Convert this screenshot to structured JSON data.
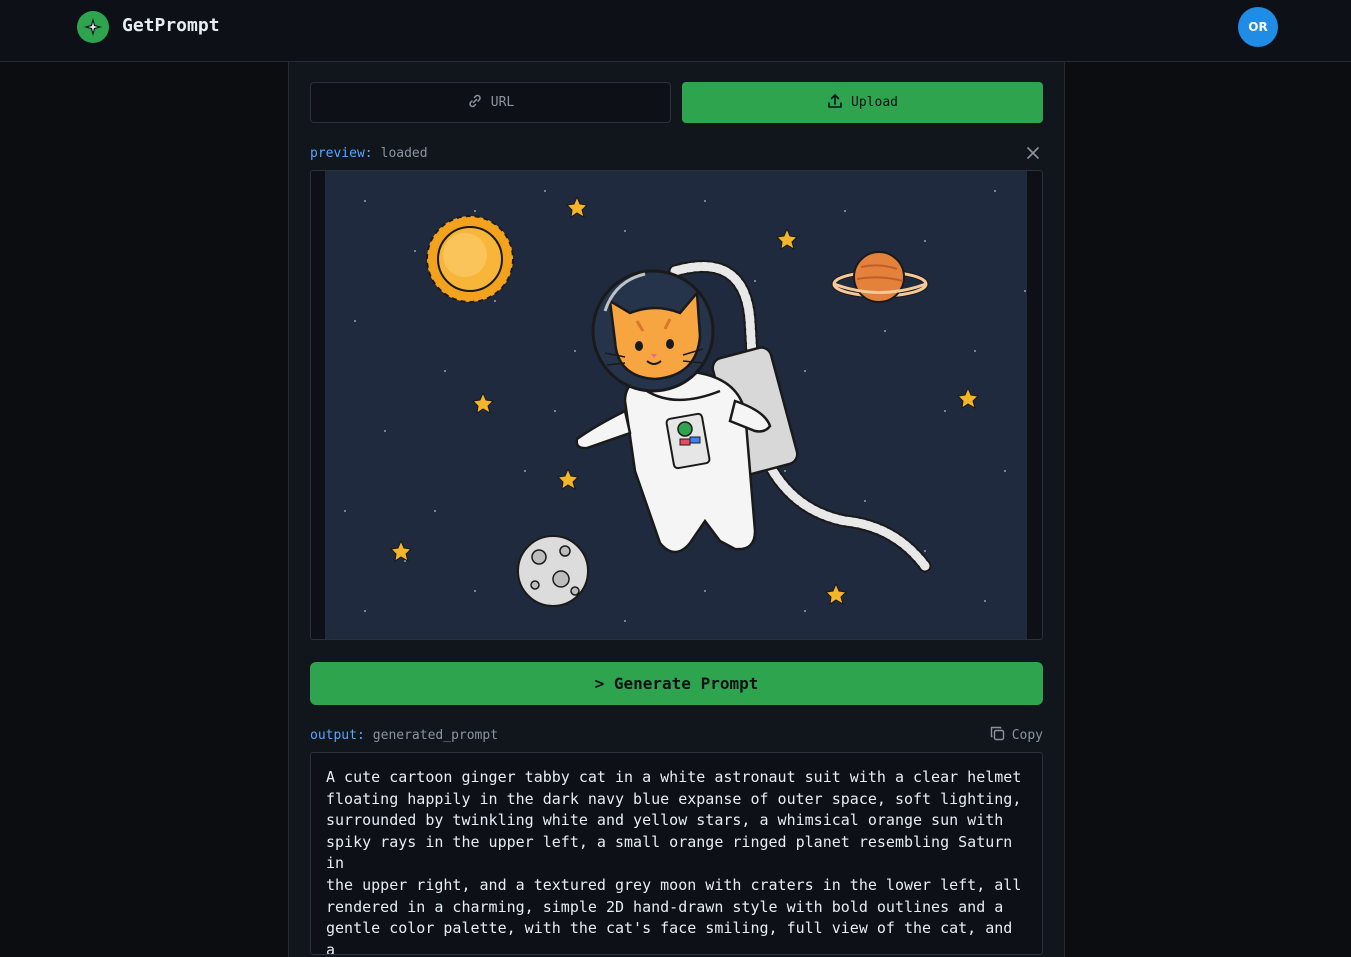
{
  "app": {
    "name": "GetPrompt",
    "avatar_initials": "OR"
  },
  "tabs": {
    "url_label": "URL",
    "upload_label": "Upload",
    "active": "Upload"
  },
  "preview": {
    "key": "preview:",
    "status": "loaded"
  },
  "generate": {
    "label": "> Generate Prompt"
  },
  "output": {
    "key": "output:",
    "name": "generated_prompt",
    "copy_label": "Copy",
    "text": "A cute cartoon ginger tabby cat in a white astronaut suit with a clear helmet\nfloating happily in the dark navy blue expanse of outer space, soft lighting,\nsurrounded by twinkling white and yellow stars, a whimsical orange sun with\nspiky rays in the upper left, a small orange ringed planet resembling Saturn in\nthe upper right, and a textured grey moon with craters in the lower left, all\nrendered in a charming, simple 2D hand-drawn style with bold outlines and a\ngentle color palette, with the cat's face smiling, full view of the cat, and a\nsense of wonder and cosmic adventure."
  },
  "colors": {
    "accent": "#2ea44f",
    "link": "#58a6ff",
    "avatar": "#1f8ce6",
    "background": "#0b0d11"
  },
  "icons": [
    "sparkle-icon",
    "link-icon",
    "upload-icon",
    "close-icon",
    "copy-icon"
  ]
}
